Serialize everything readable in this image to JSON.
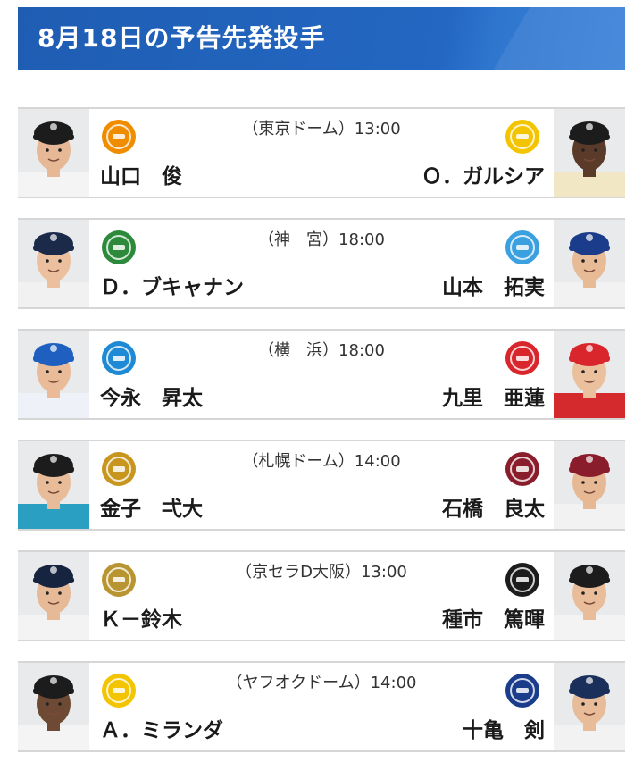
{
  "header": {
    "title": "8月18日の予告先発投手",
    "accent_color": "#1f5db3"
  },
  "games": [
    {
      "venue": "（東京ドーム）13:00",
      "home": {
        "pitcher": "山口　俊",
        "team_logo_icon": "giants-logo-icon",
        "logo_color": "#f08c00",
        "cap_color": "#1c1c1c"
      },
      "away": {
        "pitcher": "Ｏ．ガルシア",
        "team_logo_icon": "tigers-logo-icon",
        "logo_color": "#f3c400",
        "cap_color": "#1c1c1c"
      }
    },
    {
      "venue": "（神　宮）18:00",
      "home": {
        "pitcher": "Ｄ．ブキャナン",
        "team_logo_icon": "swallows-logo-icon",
        "logo_color": "#2c8a3a",
        "cap_color": "#1c2a4a"
      },
      "away": {
        "pitcher": "山本　拓実",
        "team_logo_icon": "dragons-logo-icon",
        "logo_color": "#3aa0e0",
        "cap_color": "#1a3c8a"
      }
    },
    {
      "venue": "（横　浜）18:00",
      "home": {
        "pitcher": "今永　昇太",
        "team_logo_icon": "baystars-logo-icon",
        "logo_color": "#1e8ad6",
        "cap_color": "#1e5fc0"
      },
      "away": {
        "pitcher": "九里　亜蓮",
        "team_logo_icon": "carp-logo-icon",
        "logo_color": "#d9262c",
        "cap_color": "#d9262c"
      }
    },
    {
      "venue": "（札幌ドーム）14:00",
      "home": {
        "pitcher": "金子　弌大",
        "team_logo_icon": "fighters-logo-icon",
        "logo_color": "#c8961e",
        "cap_color": "#1c1c1c"
      },
      "away": {
        "pitcher": "石橋　良太",
        "team_logo_icon": "eagles-logo-icon",
        "logo_color": "#8a1d2c",
        "cap_color": "#8a1d2c"
      }
    },
    {
      "venue": "（京セラD大阪）13:00",
      "home": {
        "pitcher": "Ｋ－鈴木",
        "team_logo_icon": "buffaloes-logo-icon",
        "logo_color": "#b89530",
        "cap_color": "#16243f"
      },
      "away": {
        "pitcher": "種市　篤暉",
        "team_logo_icon": "marines-logo-icon",
        "logo_color": "#1c1c1c",
        "cap_color": "#1c1c1c"
      }
    },
    {
      "venue": "（ヤフオクドーム）14:00",
      "home": {
        "pitcher": "Ａ．ミランダ",
        "team_logo_icon": "hawks-logo-icon",
        "logo_color": "#f3c400",
        "cap_color": "#1c1c1c"
      },
      "away": {
        "pitcher": "十亀　剣",
        "team_logo_icon": "lions-logo-icon",
        "logo_color": "#1a3c8a",
        "cap_color": "#1a2f5a"
      }
    }
  ]
}
